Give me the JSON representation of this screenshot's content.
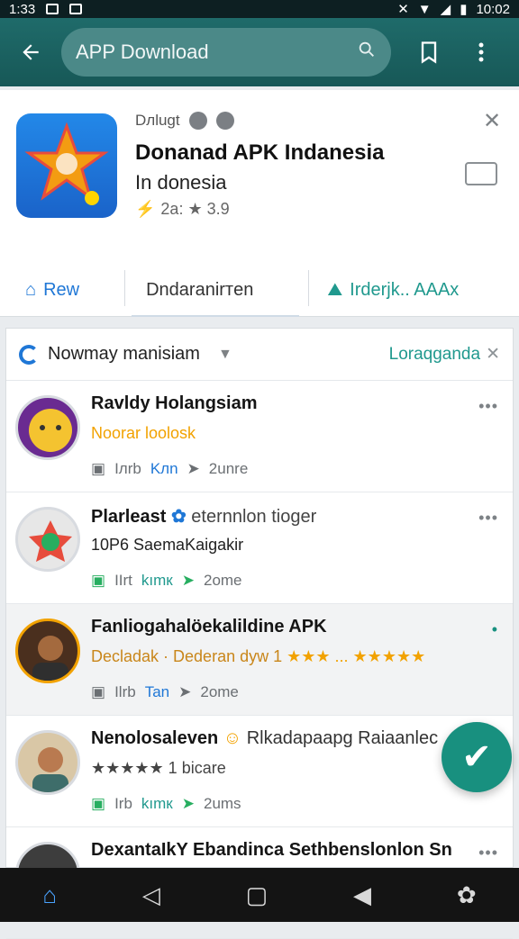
{
  "status": {
    "time": "1:33",
    "right_time": "10:02"
  },
  "appbar": {
    "search_placeholder": "APP Download"
  },
  "app": {
    "meta_label": "Dлlugt",
    "title": "Donanad APK Indanesia",
    "subtitle": "In donesia",
    "rating": "2a: ★ 3.9"
  },
  "actions": {
    "left": "Rew",
    "middle": "Dndaranirтen",
    "right": "Irderjk.. AAAx"
  },
  "list": {
    "header_title": "Nowmay manisiam",
    "header_right": "Loraqganda",
    "items": [
      {
        "title": "Ravldy Holangsiam",
        "subtitle": "Noorar loolosk",
        "tag": "Iлrb",
        "highlight": "Kлn",
        "time": "2unre"
      },
      {
        "title": "Plarleast",
        "extra": "eternnlon tioger",
        "subtitle": "10P6 SaemaKaigakir",
        "tag": "IIrt",
        "highlight": "kımк",
        "time": "2ome"
      },
      {
        "title": "Fanliogahalöekalildine APK",
        "subtitle": "Decladak · Dederan dyw 1",
        "tag": "Ilrb",
        "highlight": "Tan",
        "time": "2ome"
      },
      {
        "title": "Nenolosaleven",
        "extra": "Rlkadapaapg Raiaanlec",
        "subtitle": "★★★★★ 1 bicare",
        "tag": "Irb",
        "highlight": "kımк",
        "time": "2ums"
      },
      {
        "title": "DexantaIkY Ebandinca Sethbenslonlon Sn",
        "subtitle": "",
        "tag": "",
        "highlight": "",
        "time": ""
      }
    ]
  },
  "colors": {
    "accent": "#1f6b6a",
    "teal": "#20998e",
    "orange": "#f2a200",
    "blue": "#1f77d6"
  }
}
